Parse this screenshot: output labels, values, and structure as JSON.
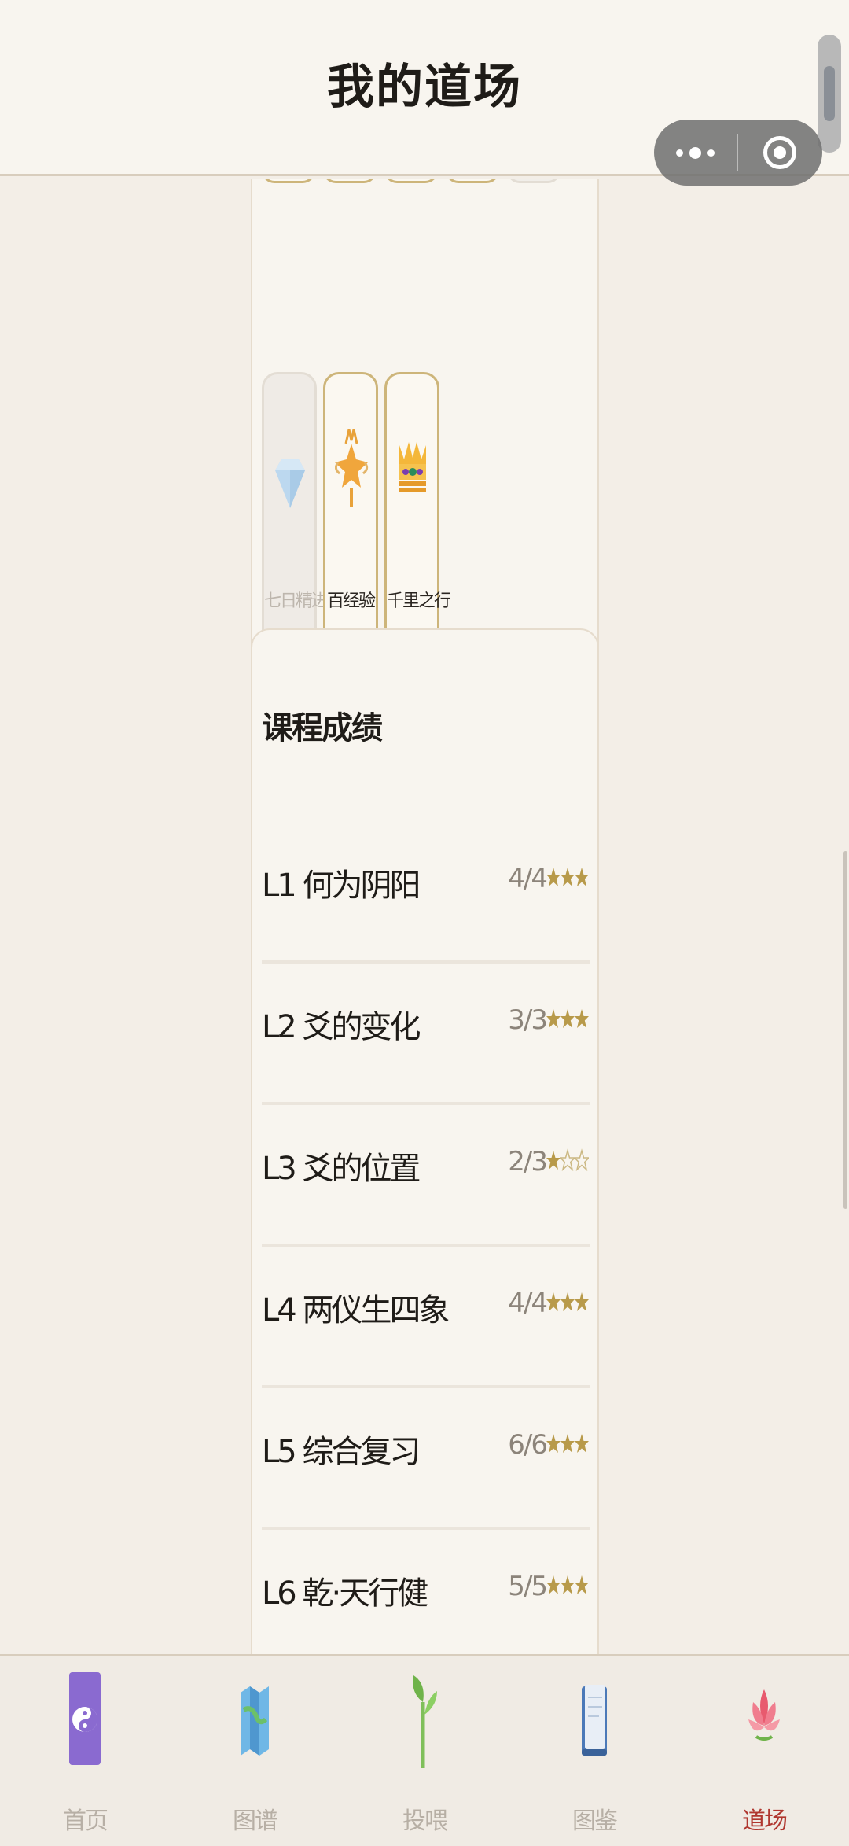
{
  "header": {
    "title": "我的道场"
  },
  "badges": [
    {
      "label": "七日精进",
      "icon": "diamond-icon",
      "locked": true
    },
    {
      "label": "百经验",
      "icon": "star-trophy-icon",
      "locked": false
    },
    {
      "label": "千里之行",
      "icon": "crown-icon",
      "locked": false
    }
  ],
  "scores": {
    "title": "课程成绩",
    "rows": [
      {
        "name": "L1 何为阴阳",
        "score": "4/4",
        "stars": 3
      },
      {
        "name": "L2 爻的变化",
        "score": "3/3",
        "stars": 3
      },
      {
        "name": "L3 爻的位置",
        "score": "2/3",
        "stars": 1
      },
      {
        "name": "L4 两仪生四象",
        "score": "4/4",
        "stars": 3
      },
      {
        "name": "L5 综合复习",
        "score": "6/6",
        "stars": 3
      },
      {
        "name": "L6 乾·天行健",
        "score": "5/5",
        "stars": 3
      }
    ]
  },
  "tabs": [
    {
      "label": "首页",
      "icon": "yin-yang-icon",
      "active": false
    },
    {
      "label": "图谱",
      "icon": "map-icon",
      "active": false
    },
    {
      "label": "投喂",
      "icon": "sprout-icon",
      "active": false
    },
    {
      "label": "图鉴",
      "icon": "book-icon",
      "active": false
    },
    {
      "label": "道场",
      "icon": "lotus-icon",
      "active": true
    }
  ],
  "colors": {
    "accent": "#b0372f",
    "gold": "#b89a4a",
    "background": "#f3eee7"
  }
}
